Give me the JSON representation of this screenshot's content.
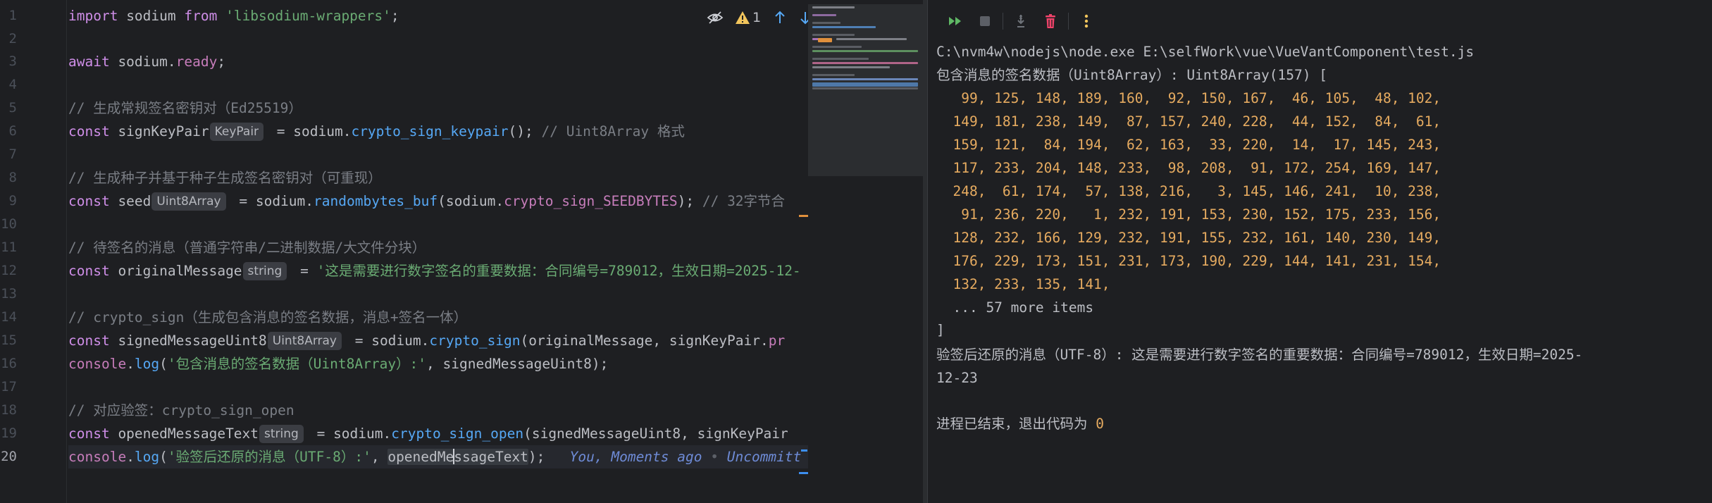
{
  "editor": {
    "line_numbers": [
      "1",
      "2",
      "3",
      "4",
      "5",
      "6",
      "7",
      "8",
      "9",
      "10",
      "11",
      "12",
      "13",
      "14",
      "15",
      "16",
      "17",
      "18",
      "19",
      "20"
    ],
    "active_line": "20",
    "toolbar": {
      "warning_count": "1"
    },
    "lines": {
      "l1": {
        "kw": "import",
        "id": " sodium ",
        "kw2": "from",
        "str": " 'libsodium-wrappers'",
        "tail": ";"
      },
      "l3": {
        "kw": "await",
        "id": " sodium.",
        "prop": "ready",
        "tail": ";"
      },
      "l5": {
        "cmt": "// 生成常规签名密钥对（Ed25519）"
      },
      "l6": {
        "kw": "const",
        "id": " signKeyPair",
        "hint": "KeyPair",
        "eq": " = sodium.",
        "fn": "crypto_sign_keypair",
        "tail": "(); ",
        "cmt": "// Uint8Array 格式"
      },
      "l8": {
        "cmt": "// 生成种子并基于种子生成签名密钥对（可重现）"
      },
      "l9": {
        "kw": "const",
        "id": " seed",
        "hint": "Uint8Array",
        "eq": " = sodium.",
        "fn": "randombytes_buf",
        "open": "(sodium.",
        "cst": "crypto_sign_SEEDBYTES",
        "tail": "); ",
        "cmt": "// 32字节合"
      },
      "l11": {
        "cmt": "// 待签名的消息（普通字符串/二进制数据/大文件分块）"
      },
      "l12": {
        "kw": "const",
        "id": " originalMessage",
        "hint": "string",
        "eq": " = ",
        "str": "'这是需要进行数字签名的重要数据：合同编号=789012，生效日期=2025-12-"
      },
      "l14": {
        "cmt": "// crypto_sign（生成包含消息的签名数据，消息+签名一体）"
      },
      "l15": {
        "kw": "const",
        "id": " signedMessageUint8",
        "hint": "Uint8Array",
        "eq": " = sodium.",
        "fn": "crypto_sign",
        "open": "(originalMessage, signKeyPair.",
        "cst": "pr"
      },
      "l16": {
        "fn": "console",
        "dot": ".",
        "fn2": "log",
        "open": "(",
        "str": "'包含消息的签名数据（Uint8Array）:'",
        "tail": ", signedMessageUint8);"
      },
      "l18": {
        "cmt": "// 对应验签：crypto_sign_open"
      },
      "l19": {
        "kw": "const",
        "id": " openedMessageText",
        "hint": "string",
        "eq": " = sodium.",
        "fn": "crypto_sign_open",
        "open": "(signedMessageUint8, signKeyPair"
      },
      "l20": {
        "fn": "console",
        "dot": ".",
        "fn2": "log",
        "open": "(",
        "str": "'验签后还原的消息（UTF-8）:'",
        "comma": ", ",
        "hl1": "openedMe",
        "hl2": "ssageText",
        "tail": ");",
        "blame_user": "You,",
        "blame_time": " Moments ago",
        "blame_dot": " • ",
        "blame_status": "Uncommitt"
      }
    }
  },
  "console": {
    "command": "C:\\nvm4w\\nodejs\\node.exe E:\\selfWork\\vue\\VueVantComponent\\test.js",
    "array_header": "包含消息的签名数据（Uint8Array）: Uint8Array(157) [",
    "rows": [
      "   99, 125, 148, 189, 160,  92, 150, 167,  46, 105,  48, 102,",
      "  149, 181, 238, 149,  87, 157, 240, 228,  44, 152,  84,  61,",
      "  159, 121,  84, 194,  62, 163,  33, 220,  14,  17, 145, 243,",
      "  117, 233, 204, 148, 233,  98, 208,  91, 172, 254, 169, 147,",
      "  248,  61, 174,  57, 138, 216,   3, 145, 146, 241,  10, 238,",
      "   91, 236, 220,   1, 232, 191, 153, 230, 152, 175, 233, 156,",
      "  128, 232, 166, 129, 232, 191, 155, 232, 161, 140, 230, 149,",
      "  176, 229, 173, 151, 231, 173, 190, 229, 144, 141, 231, 154,",
      "  132, 233, 135, 141,"
    ],
    "more_items": "  ... 57 more items",
    "array_close": "]",
    "opened_line1": "验签后还原的消息（UTF-8）: 这是需要进行数字签名的重要数据：合同编号=789012，生效日期=2025-",
    "opened_line2": "12-23",
    "exit_prefix": "进程已结束，退出代码为 ",
    "exit_code": "0"
  },
  "colors": {
    "keyword": "#cf8ee8",
    "string": "#6aab73",
    "comment": "#7a7e85",
    "function": "#56a8f5",
    "constant": "#c77dbb",
    "number": "#e6ab60",
    "background": "#1e1f22"
  },
  "icons": {
    "editor_toolbar": [
      "eye-off-icon",
      "warning-icon",
      "arrow-up-icon",
      "arrow-down-icon"
    ],
    "run_toolbar": [
      "rerun-icon",
      "stop-icon",
      "scroll-to-end-icon",
      "clear-icon",
      "more-icon"
    ]
  }
}
